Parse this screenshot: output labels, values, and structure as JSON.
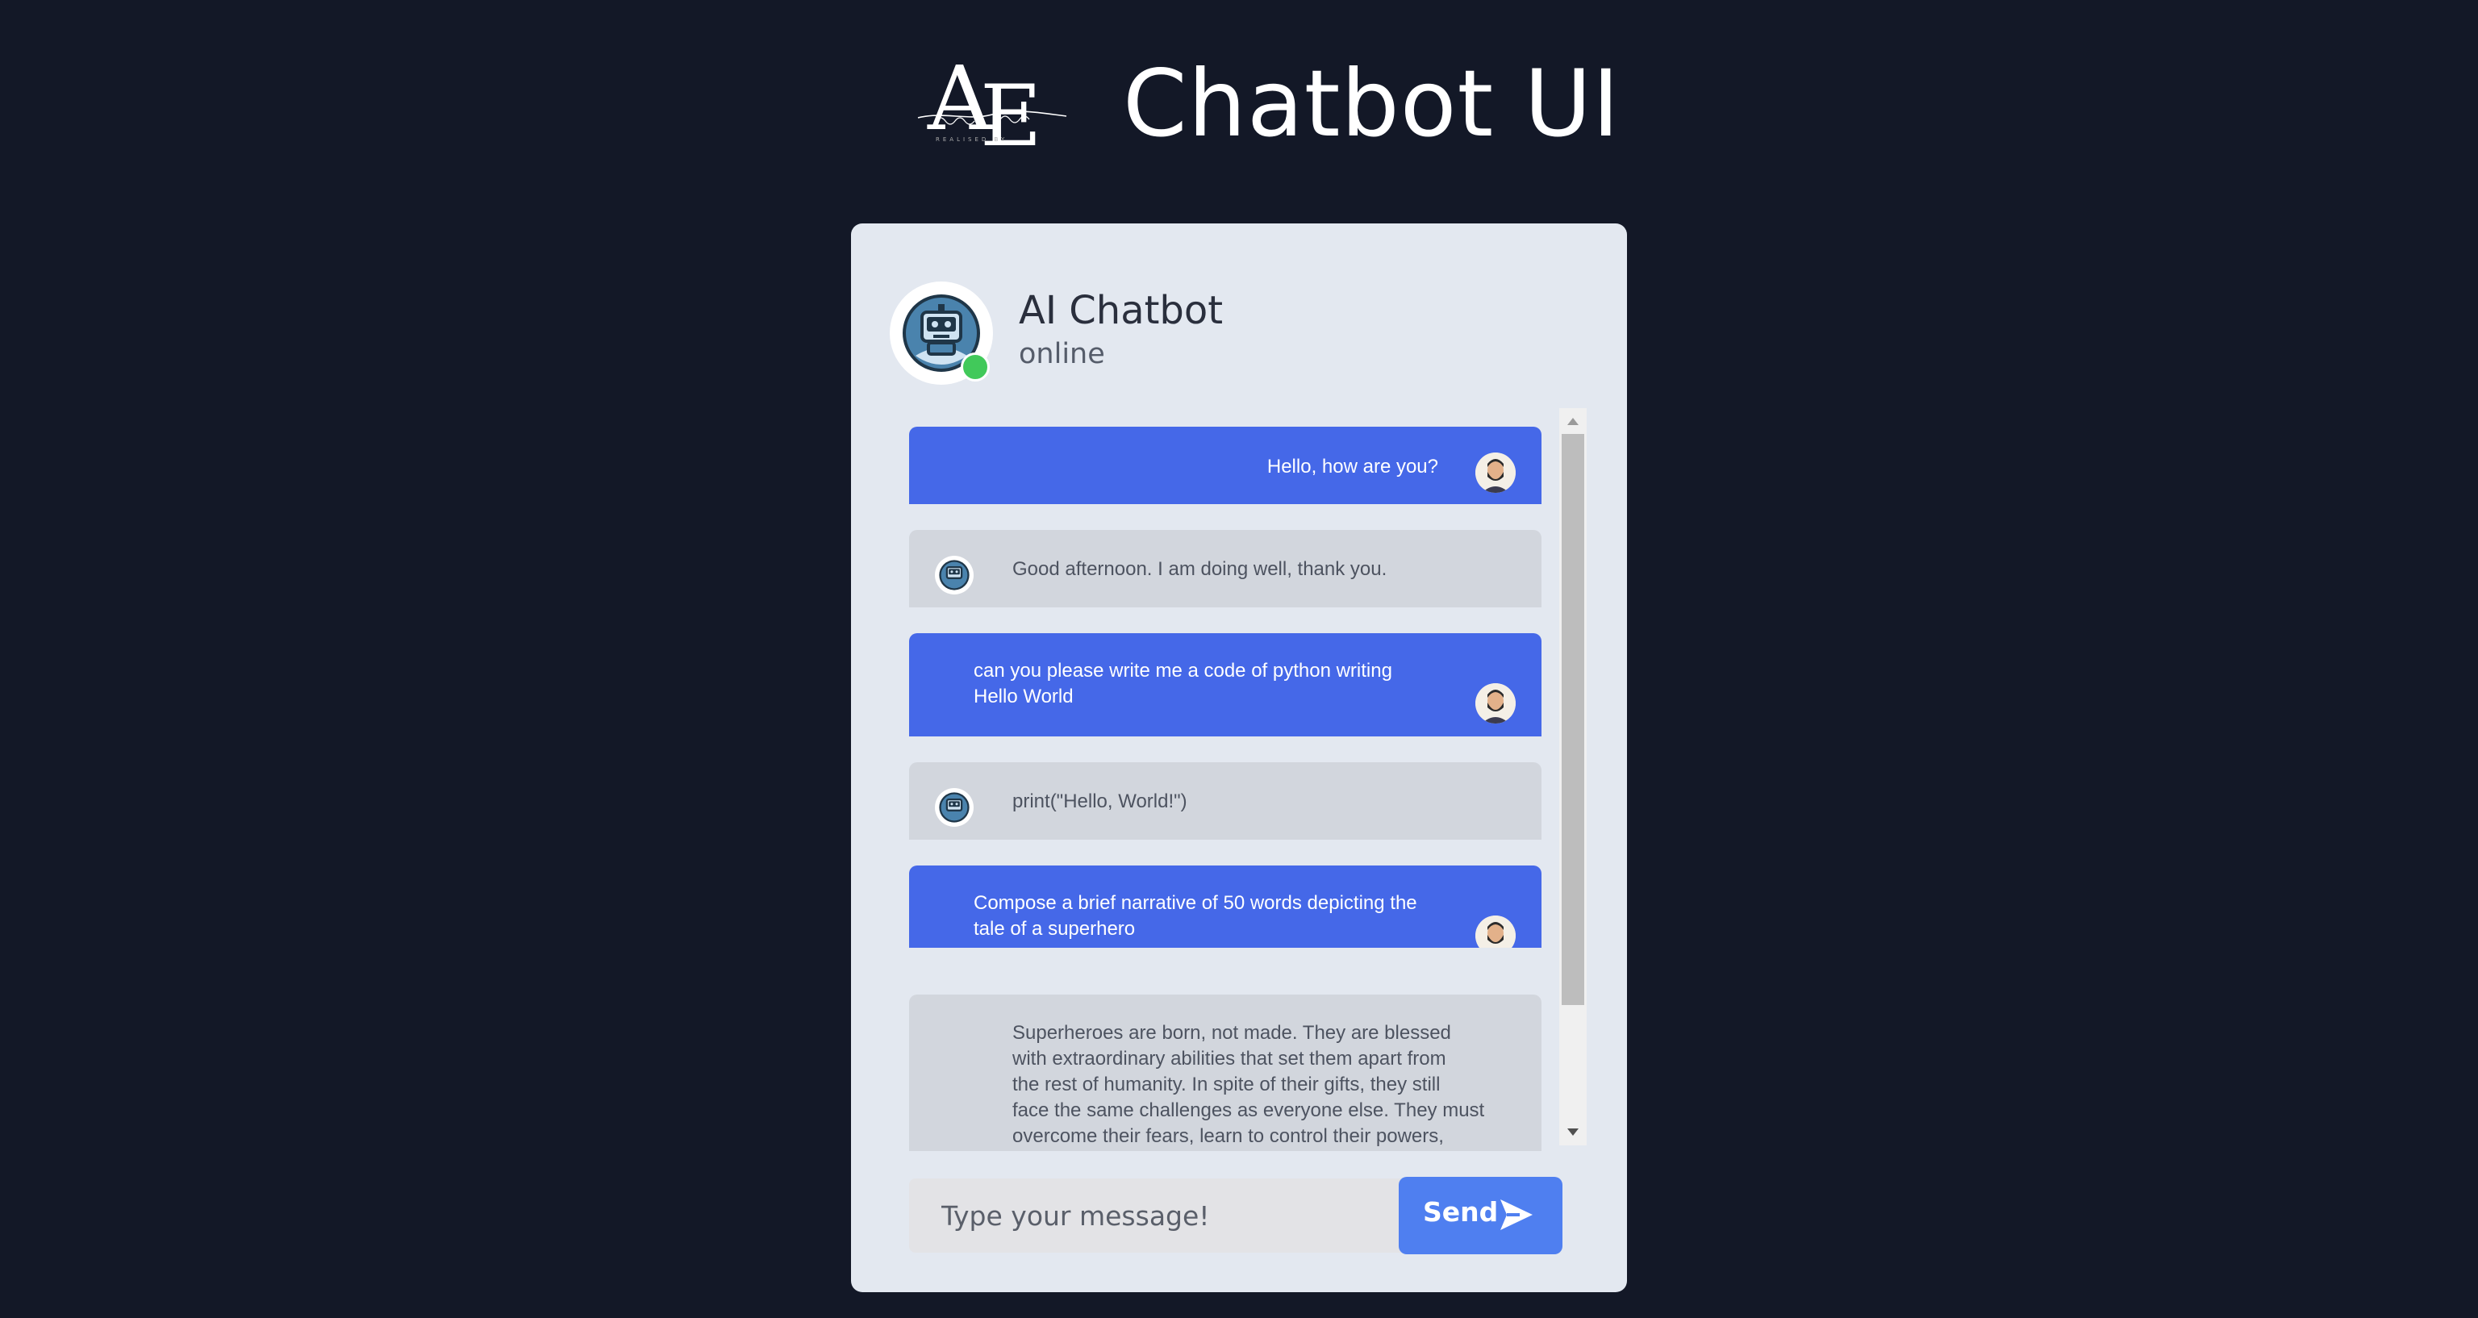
{
  "header": {
    "logo_text": "AE",
    "logo_signature": "Abderrahmane Ebdaly",
    "title": "Chatbot UI"
  },
  "bot": {
    "name": "AI Chatbot",
    "status": "online",
    "status_color": "#41c95a"
  },
  "messages": [
    {
      "sender": "user",
      "text": "Hello, how are you?"
    },
    {
      "sender": "bot",
      "text": "Good afternoon. I am doing well, thank you."
    },
    {
      "sender": "user",
      "text": "can you please write me a code of python writing\nHello World"
    },
    {
      "sender": "bot",
      "text": "print(\"Hello, World!\")"
    },
    {
      "sender": "user",
      "text": "Compose a brief narrative of 50 words depicting the\ntale of a superhero"
    },
    {
      "sender": "bot",
      "text": "Superheroes are born, not made. They are blessed\nwith extraordinary abilities that set them apart from\nthe rest of humanity. In spite of their gifts, they still\nface the same challenges as everyone else. They must\novercome their fears, learn to control their powers,"
    }
  ],
  "input": {
    "placeholder": "Type your message!",
    "value": ""
  },
  "send_button": {
    "label": "Send",
    "icon": "send-icon"
  },
  "colors": {
    "background": "#131827",
    "card": "#e3e8f0",
    "user_bubble": "#4568e8",
    "bot_bubble": "#d2d6dd",
    "send_button": "#4f7ff0"
  }
}
